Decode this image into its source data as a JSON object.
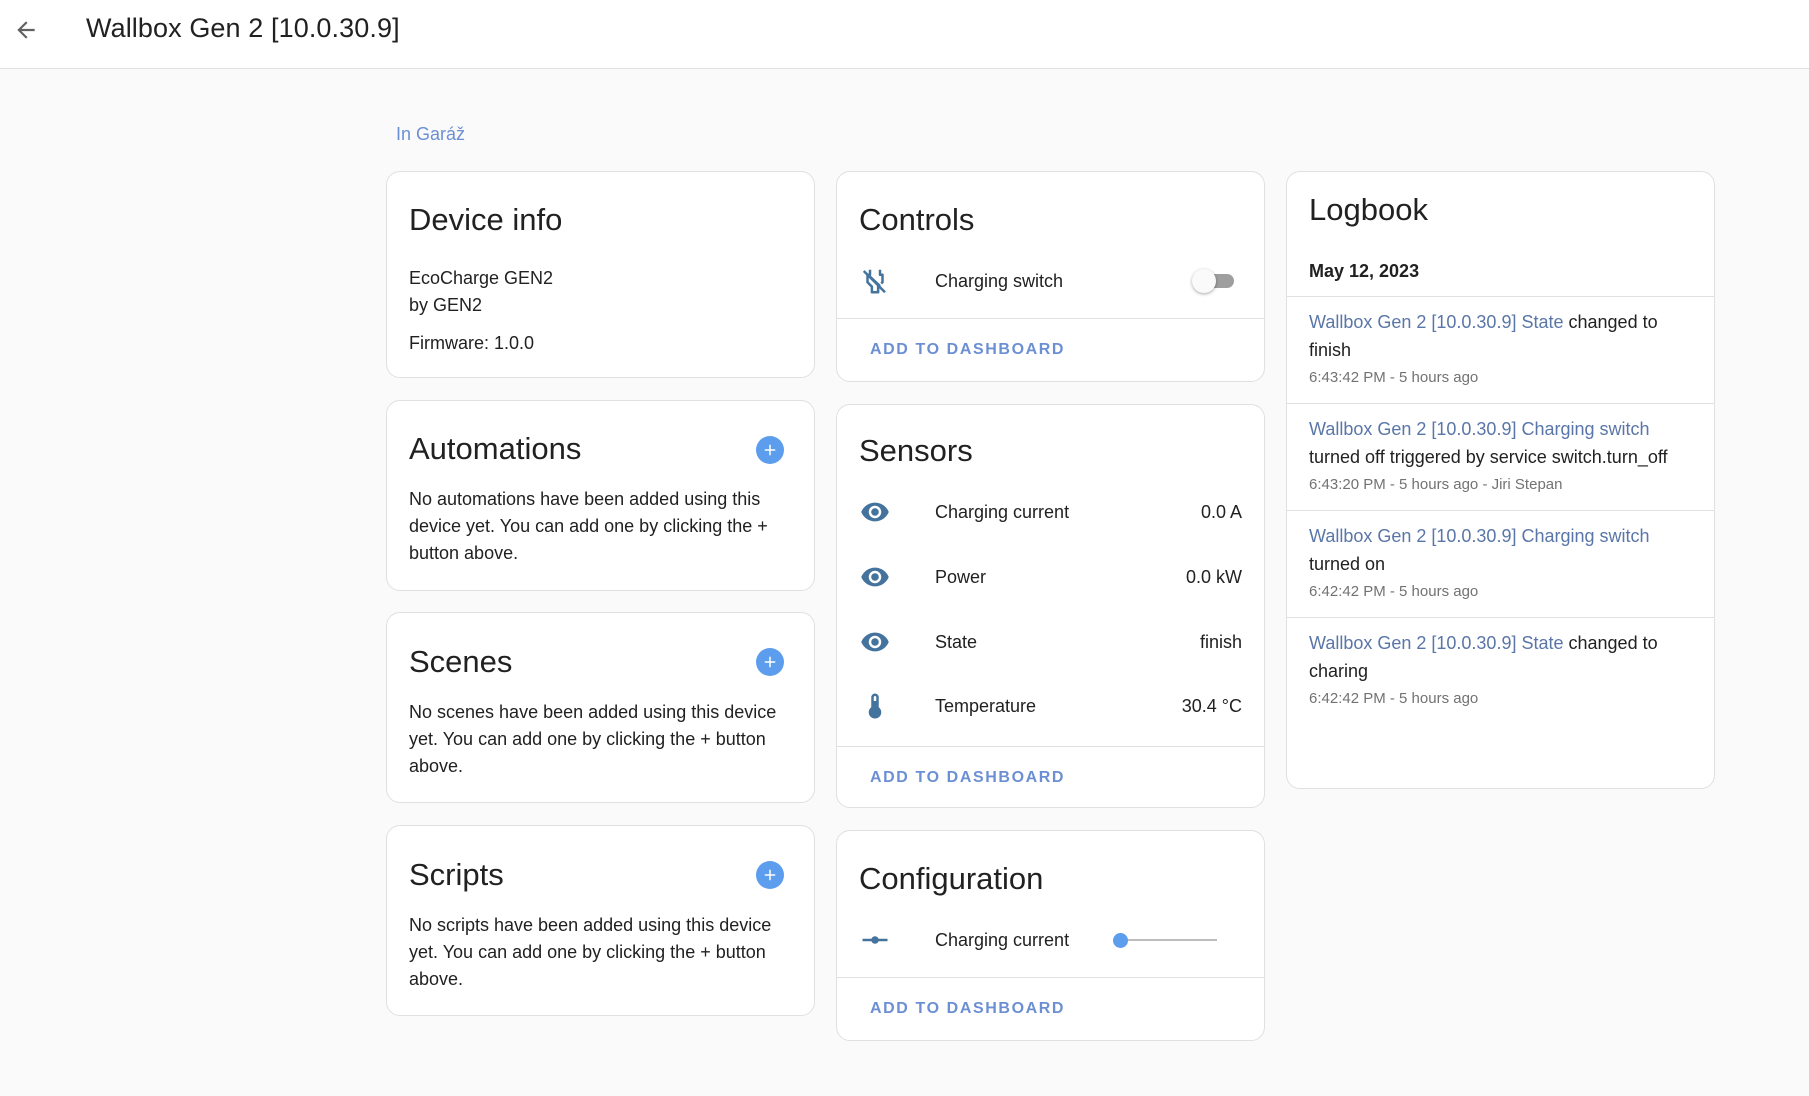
{
  "header": {
    "title": "Wallbox Gen 2 [10.0.30.9]",
    "back_icon": "arrow-left-icon"
  },
  "area": {
    "label": "In Garáž"
  },
  "device_info": {
    "title": "Device info",
    "model": "EcoCharge GEN2",
    "manufacturer": "by GEN2",
    "firmware": "Firmware: 1.0.0"
  },
  "automations": {
    "title": "Automations",
    "text": "No automations have been added using this device yet. You can add one by clicking the + button above."
  },
  "scenes": {
    "title": "Scenes",
    "text": "No scenes have been added using this device yet. You can add one by clicking the + button above."
  },
  "scripts": {
    "title": "Scripts",
    "text": "No scripts have been added using this device yet. You can add one by clicking the + button above."
  },
  "controls": {
    "title": "Controls",
    "items": [
      {
        "label": "Charging switch",
        "icon": "power-plug-off-icon",
        "state": "off"
      }
    ],
    "add_label": "ADD TO DASHBOARD"
  },
  "sensors": {
    "title": "Sensors",
    "items": [
      {
        "label": "Charging current",
        "value": "0.0 A",
        "icon": "eye-icon"
      },
      {
        "label": "Power",
        "value": "0.0 kW",
        "icon": "eye-icon"
      },
      {
        "label": "State",
        "value": "finish",
        "icon": "eye-icon"
      },
      {
        "label": "Temperature",
        "value": "30.4 °C",
        "icon": "thermometer-icon"
      }
    ],
    "add_label": "ADD TO DASHBOARD"
  },
  "configuration": {
    "title": "Configuration",
    "items": [
      {
        "label": "Charging current",
        "icon": "slider-icon",
        "level": 0.0
      }
    ],
    "add_label": "ADD TO DASHBOARD"
  },
  "logbook": {
    "title": "Logbook",
    "date": "May 12, 2023",
    "entries": [
      {
        "entity": "Wallbox Gen 2 [10.0.30.9] State",
        "message": "changed to",
        "message2": "finish",
        "meta": "6:43:42 PM - 5 hours ago"
      },
      {
        "entity": "Wallbox Gen 2 [10.0.30.9] Charging switch",
        "message": "",
        "message2": "turned off triggered by service switch.turn_off",
        "meta": "6:43:20 PM - 5 hours ago - Jiri Stepan"
      },
      {
        "entity": "Wallbox Gen 2 [10.0.30.9] Charging switch",
        "message": "",
        "message2": "turned on",
        "meta": "6:42:42 PM - 5 hours ago"
      },
      {
        "entity": "Wallbox Gen 2 [10.0.30.9] State",
        "message": "changed to",
        "message2": "charing",
        "meta": "6:42:42 PM - 5 hours ago"
      }
    ]
  },
  "colors": {
    "accent": "#5c9ded",
    "link": "#6c8fd4",
    "icon": "#44739e"
  }
}
